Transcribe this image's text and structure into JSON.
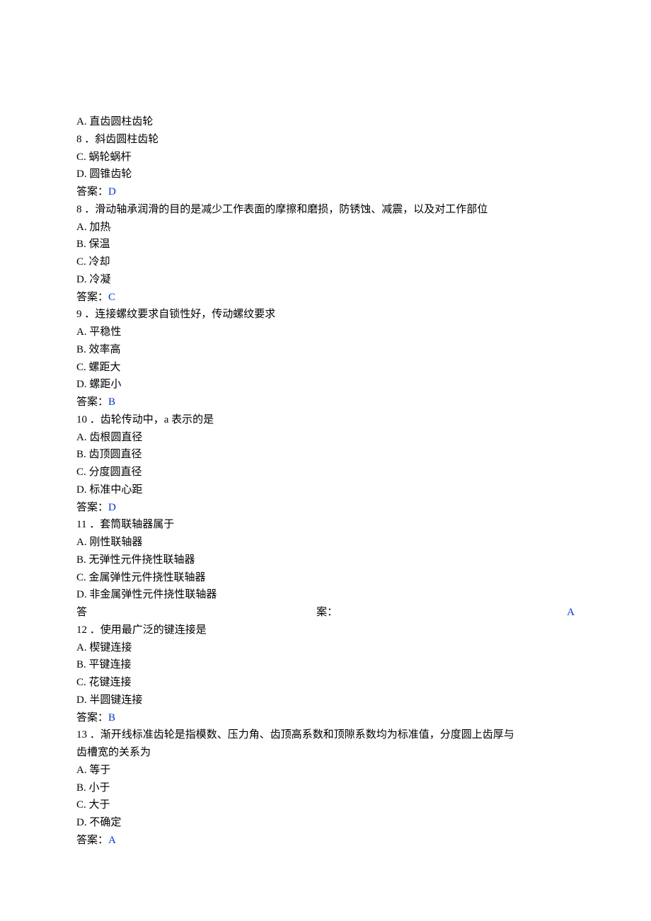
{
  "q7_options": {
    "A": "A. 直齿圆柱齿轮",
    "B": "8 ．斜齿圆柱齿轮",
    "C": "C. 蜗轮蜗杆",
    "D": "D. 圆锥齿轮"
  },
  "q7_answer_label": "答案：",
  "q7_answer_value": "D",
  "q8": {
    "stem": "8 ．滑动轴承润滑的目的是减少工作表面的摩擦和磨损，防锈蚀、减震，以及对工作部位",
    "A": "A. 加热",
    "B": "B. 保温",
    "C": "C. 冷却",
    "D": "D. 冷凝",
    "answer_label": "答案：",
    "answer_value": "C"
  },
  "q9": {
    "stem": "9 ．连接螺纹要求自锁性好，传动螺纹要求",
    "A": "A. 平稳性",
    "B": "B. 效率高",
    "C": "C. 螺距大",
    "D": "D. 螺距小",
    "answer_label": "答案：",
    "answer_value": "B"
  },
  "q10": {
    "stem": "10 ．齿轮传动中，a 表示的是",
    "A": "A. 齿根圆直径",
    "B": "B. 齿顶圆直径",
    "C": "C. 分度圆直径",
    "D": "D. 标准中心距",
    "answer_label": "答案：",
    "answer_value": "D"
  },
  "q11": {
    "stem": "11 ．套筒联轴器属于",
    "A": "A. 刚性联轴器",
    "B": "B. 无弹性元件挠性联轴器",
    "C": "C. 金属弹性元件挠性联轴器",
    "D": "D. 非金属弹性元件挠性联轴器",
    "answer_left": "答",
    "answer_mid": "案：",
    "answer_value": "A"
  },
  "q12": {
    "stem": "12 ．使用最广泛的键连接是",
    "A": "A. 楔键连接",
    "B": "B. 平键连接",
    "C": "C. 花键连接",
    "D": "D. 半圆键连接",
    "answer_label": "答案：",
    "answer_value": "B"
  },
  "q13": {
    "stem1": "13 ．渐开线标准齿轮是指模数、压力角、齿顶高系数和顶隙系数均为标准值，分度圆上齿厚与",
    "stem2": "齿槽宽的关系为",
    "A": "A. 等于",
    "B": "B. 小于",
    "C": "C. 大于",
    "D": "D. 不确定",
    "answer_label": "答案：",
    "answer_value": "A"
  }
}
